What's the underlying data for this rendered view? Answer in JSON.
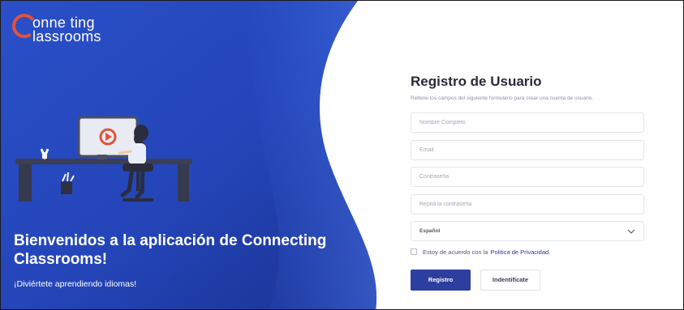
{
  "brand": {
    "logo_line1": "onne ting",
    "logo_line2": "lassrooms"
  },
  "hero": {
    "title": "Bienvenidos a la aplicación de Connecting Classrooms!",
    "subtitle": "¡Diviértete aprendiendo idiomas!"
  },
  "form": {
    "title": "Registro de Usuario",
    "description": "Rellene los campos del siguiente formulario para crear una cuenta de usuario.",
    "fields": {
      "full_name_placeholder": "Nombre Completo",
      "email_placeholder": "Email",
      "password_placeholder": "Contraseña",
      "repeat_password_placeholder": "Repita la contraseña"
    },
    "language_select": {
      "selected": "Español"
    },
    "terms": {
      "text": "Estoy de acuerdo con la",
      "link": "Politica de Privacidad."
    },
    "buttons": {
      "register": "Registro",
      "login": "Indentifícate"
    }
  },
  "colors": {
    "primary_blue": "#2c3e9e",
    "panel_dark": "#1f3aa6",
    "panel_light": "#3b5fd6",
    "logo_accent": "#e2533a"
  },
  "icons": {
    "select_arrow": "chevron-down-icon",
    "illustration": "person-at-desk-with-video-screen"
  }
}
